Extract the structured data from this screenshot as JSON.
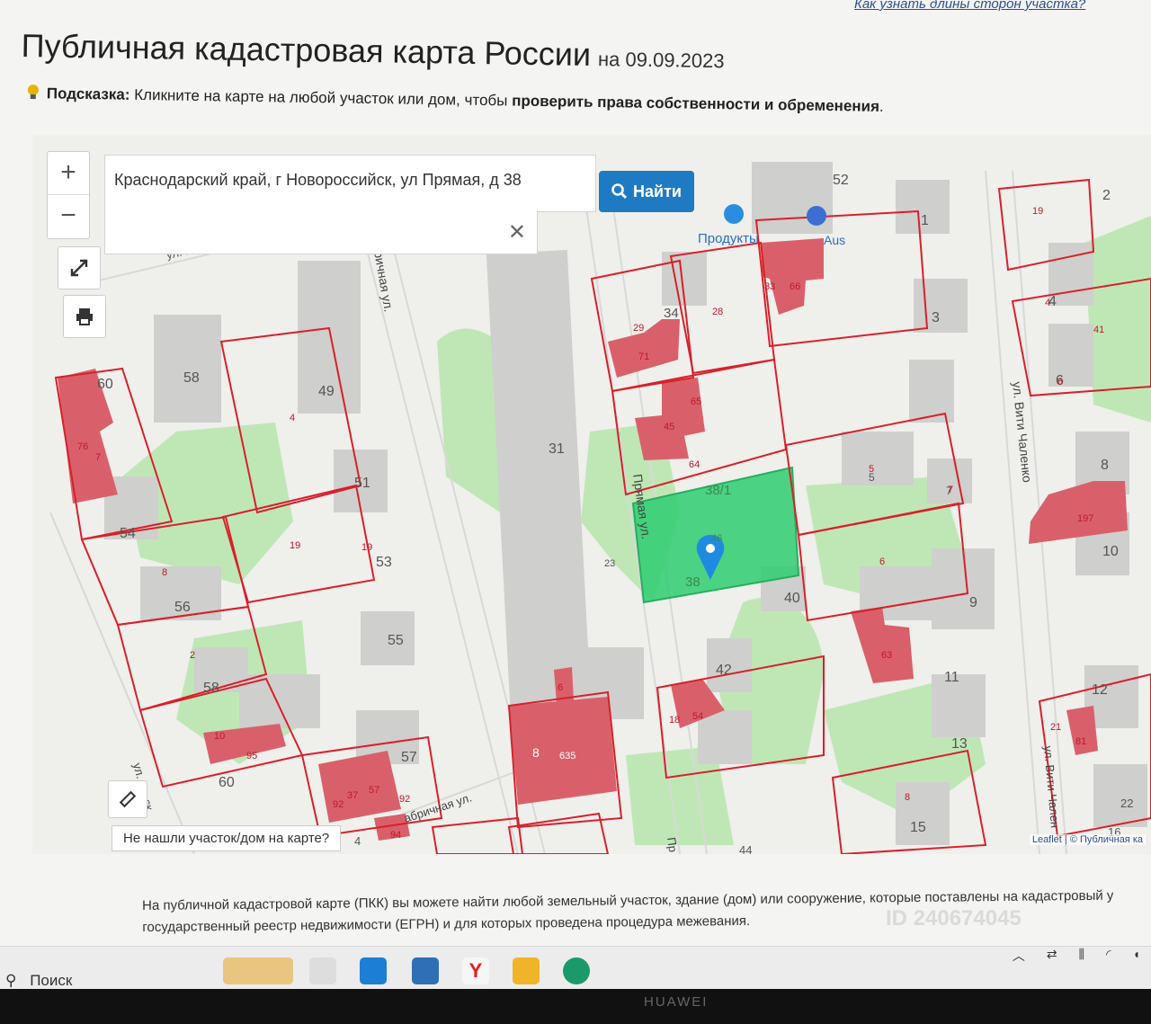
{
  "header": {
    "top_link": "Как узнать длины сторон участка?",
    "title": "Публичная кадастровая карта России",
    "date": "на 09.09.2023",
    "hint_label": "Подсказка:",
    "hint_text": "Кликните на карте на любой участок или дом, чтобы",
    "hint_bold": "проверить права собственности и обременения",
    "hint_end": "."
  },
  "search": {
    "value": "Краснодарский край, г Новороссийск, ул Прямая, д 38",
    "button_label": "Найти"
  },
  "map": {
    "not_found_label": "Не нашли участок/дом на карте?",
    "attribution": "Leaflet | © Публичная ка",
    "poi": [
      "Продукты",
      "Aus"
    ],
    "streets": [
      "ул. Ра...",
      "ричная ул.",
      "Прямая ул.",
      "ул. Вити Чаленко",
      "ул. Вити Чален",
      "ул. Ф...ск",
      "абричная ул.",
      "Пр"
    ],
    "house_numbers": [
      "52",
      "1",
      "3",
      "2",
      "4",
      "6",
      "8",
      "10",
      "12",
      "58",
      "60",
      "49",
      "51",
      "53",
      "54",
      "56",
      "55",
      "58",
      "60",
      "57",
      "31",
      "40",
      "42",
      "9",
      "11",
      "13",
      "15",
      "16",
      "22",
      "44",
      "34",
      "38",
      "46",
      "38/1",
      "5",
      "7",
      "23",
      "4"
    ],
    "parcel_numbers": [
      "19",
      "33",
      "66",
      "29",
      "71",
      "28",
      "65",
      "45",
      "64",
      "76",
      "7",
      "4",
      "19",
      "19",
      "8",
      "2",
      "10",
      "95",
      "92",
      "37",
      "57",
      "92",
      "94",
      "8",
      "635",
      "6",
      "18",
      "54",
      "63",
      "6",
      "5",
      "7",
      "197",
      "41",
      "21",
      "81",
      "8",
      "4",
      "6"
    ]
  },
  "info": {
    "line1": "На публичной кадастровой карте (ПКК) вы можете найти любой земельный участок, здание (дом) или сооружение, которые поставлены на кадастровый у",
    "line2": "государственный реестр недвижимости (ЕГРН) и для которых проведена процедура межевания."
  },
  "watermark": "ID 240674045",
  "taskbar": {
    "search_label": "Поиск",
    "brand": "HUAWEI"
  },
  "colors": {
    "parcel_border": "#d8202a",
    "building_fill": "#d9606a",
    "selected_parcel": "#2ecc71",
    "green_area": "#b8e6b0",
    "find_button": "#1f7ac4"
  }
}
